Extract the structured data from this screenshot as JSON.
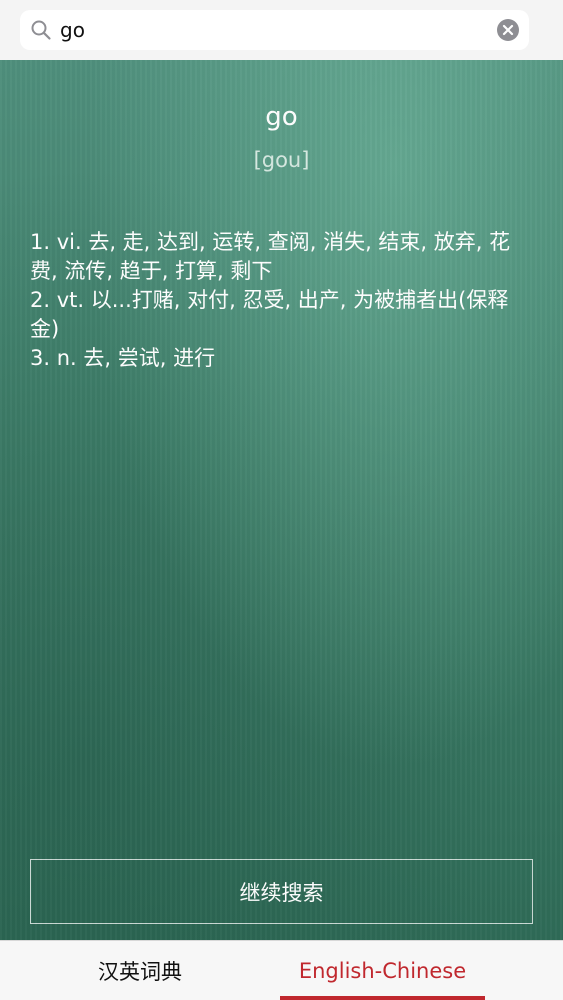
{
  "search": {
    "value": "go",
    "icon": "search-icon",
    "clear_icon": "clear-icon"
  },
  "entry": {
    "word": "go",
    "phonetic": "[gou]",
    "definitions": [
      "1.  vi. 去, 走, 达到, 运转, 查阅, 消失, 结束, 放弃, 花费, 流传, 趋于, 打算, 剩下",
      "2.  vt. 以...打赌, 对付, 忍受, 出产, 为被捕者出(保释金)",
      "3.  n. 去, 尝试, 进行"
    ]
  },
  "actions": {
    "continue_label": "继续搜索"
  },
  "tabs": {
    "items": [
      {
        "label": "汉英词典",
        "active": false
      },
      {
        "label": "English-Chinese",
        "active": true
      }
    ],
    "active_color": "#c0282e"
  },
  "colors": {
    "board": "#3f7f6a",
    "accent": "#c0282e"
  }
}
